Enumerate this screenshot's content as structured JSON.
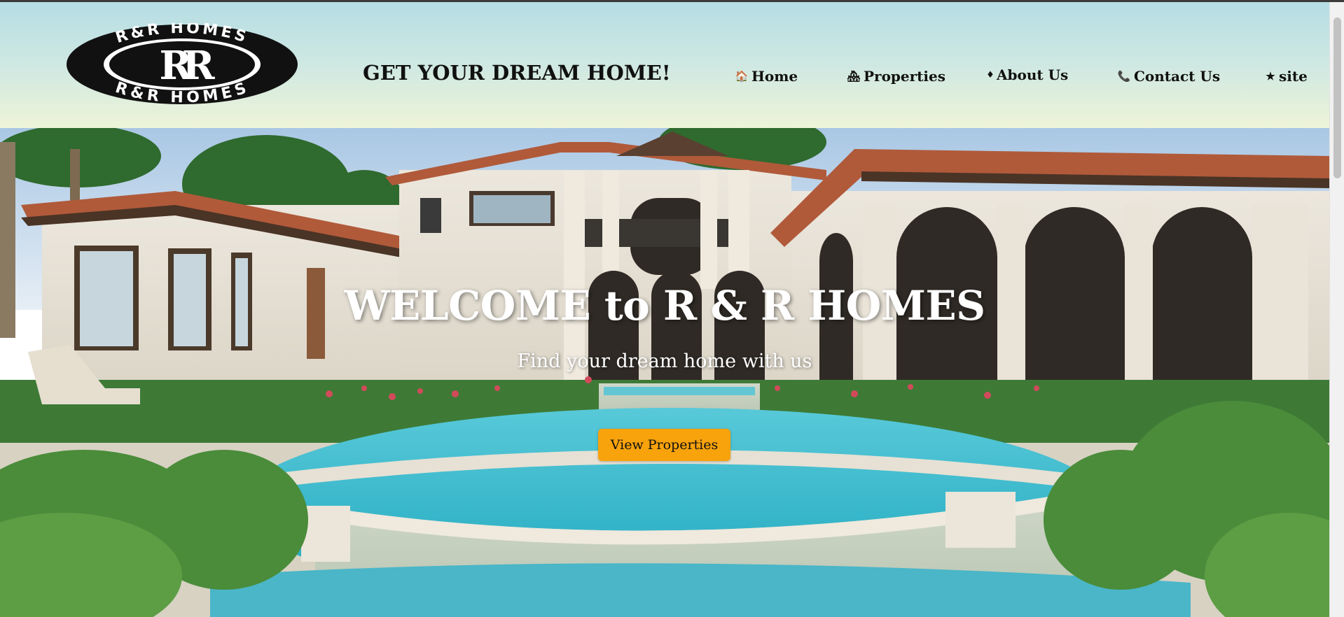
{
  "header": {
    "logo": {
      "top_text": "R&R HOMES",
      "bottom_text": "R&R HOMES",
      "monogram": "RR",
      "icon": "logo-seal"
    },
    "tagline": "GET YOUR DREAM HOME!",
    "nav": [
      {
        "label": "Home",
        "icon": "house-icon",
        "glyph": "🏠"
      },
      {
        "label": "Properties",
        "icon": "buildings-icon",
        "glyph": "🏘"
      },
      {
        "label": "About Us",
        "icon": "diamond-icon",
        "glyph": "♦"
      },
      {
        "label": "Contact Us",
        "icon": "phone-icon",
        "glyph": "📞"
      },
      {
        "label": "site",
        "icon": "star-icon",
        "glyph": "★"
      }
    ]
  },
  "hero": {
    "title": "WELCOME to R & R HOMES",
    "subtitle": "Find your dream home with us",
    "cta_label": "View Properties"
  },
  "colors": {
    "cta": "#f8a20c",
    "header_top": "#b5dde4",
    "header_bottom": "#eef4d8"
  }
}
